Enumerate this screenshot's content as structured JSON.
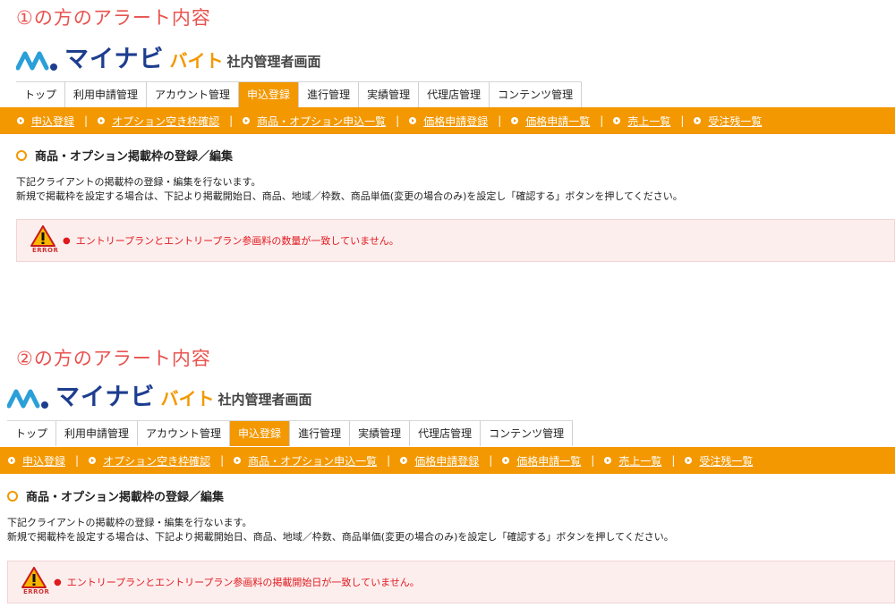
{
  "colors": {
    "orange": "#f39800",
    "navy": "#1d3d8f",
    "alert_red": "#e0191d",
    "caption_red": "#e8534f"
  },
  "sections": [
    {
      "caption": "①の方のアラート内容",
      "logo": {
        "main": "マイナビ",
        "bite": "バイト",
        "sub": "社内管理者画面"
      },
      "tabs": [
        "トップ",
        "利用申請管理",
        "アカウント管理",
        "申込登録",
        "進行管理",
        "実績管理",
        "代理店管理",
        "コンテンツ管理"
      ],
      "active_tab": "申込登録",
      "subnav": [
        "申込登録",
        "オプション空き枠確認",
        "商品・オプション申込一覧",
        "価格申請登録",
        "価格申請一覧",
        "売上一覧",
        "受注残一覧"
      ],
      "heading": "商品・オプション掲載枠の登録／編集",
      "desc_line1": "下記クライアントの掲載枠の登録・編集を行ないます。",
      "desc_line2": "新規で掲載枠を設定する場合は、下記より掲載開始日、商品、地域／枠数、商品単価(変更の場合のみ)を設定し「確認する」ボタンを押してください。",
      "alert_icon": "warning-icon",
      "alert_label": "ERROR",
      "alert_message": "エントリープランとエントリープラン参画料の数量が一致していません。"
    },
    {
      "caption": "②の方のアラート内容",
      "logo": {
        "main": "マイナビ",
        "bite": "バイト",
        "sub": "社内管理者画面"
      },
      "tabs": [
        "トップ",
        "利用申請管理",
        "アカウント管理",
        "申込登録",
        "進行管理",
        "実績管理",
        "代理店管理",
        "コンテンツ管理"
      ],
      "active_tab": "申込登録",
      "subnav": [
        "申込登録",
        "オプション空き枠確認",
        "商品・オプション申込一覧",
        "価格申請登録",
        "価格申請一覧",
        "売上一覧",
        "受注残一覧"
      ],
      "heading": "商品・オプション掲載枠の登録／編集",
      "desc_line1": "下記クライアントの掲載枠の登録・編集を行ないます。",
      "desc_line2": "新規で掲載枠を設定する場合は、下記より掲載開始日、商品、地域／枠数、商品単価(変更の場合のみ)を設定し「確認する」ボタンを押してください。",
      "alert_icon": "warning-icon",
      "alert_label": "ERROR",
      "alert_message": "エントリープランとエントリープラン参画料の掲載開始日が一致していません。"
    }
  ]
}
